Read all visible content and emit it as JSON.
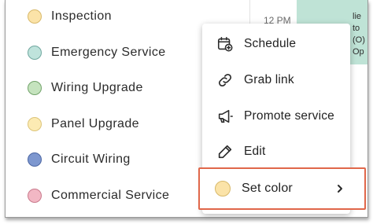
{
  "categories": [
    {
      "label": "Inspection",
      "fill": "#fbe3a8",
      "border": "#d8b96a"
    },
    {
      "label": "Emergency Service",
      "fill": "#bfe3dc",
      "border": "#6fa79f"
    },
    {
      "label": "Wiring Upgrade",
      "fill": "#c5e3be",
      "border": "#72a36a"
    },
    {
      "label": "Panel Upgrade",
      "fill": "#fcebb3",
      "border": "#dcc479"
    },
    {
      "label": "Circuit Wiring",
      "fill": "#7d97cf",
      "border": "#4b66a3"
    },
    {
      "label": "Commercial Service",
      "fill": "#f2b7c4",
      "border": "#c97a8c"
    }
  ],
  "background": {
    "time_label": "12 PM",
    "event_text": [
      "lie",
      "to",
      "(O)",
      "Op"
    ]
  },
  "menu": {
    "schedule": "Schedule",
    "grab_link": "Grab link",
    "promote": "Promote service",
    "edit": "Edit",
    "set_color": "Set color"
  },
  "colors": {
    "highlight_border": "#e0674a",
    "event_block": "#bfe3d6",
    "selected_color": "#fbe3a8"
  }
}
